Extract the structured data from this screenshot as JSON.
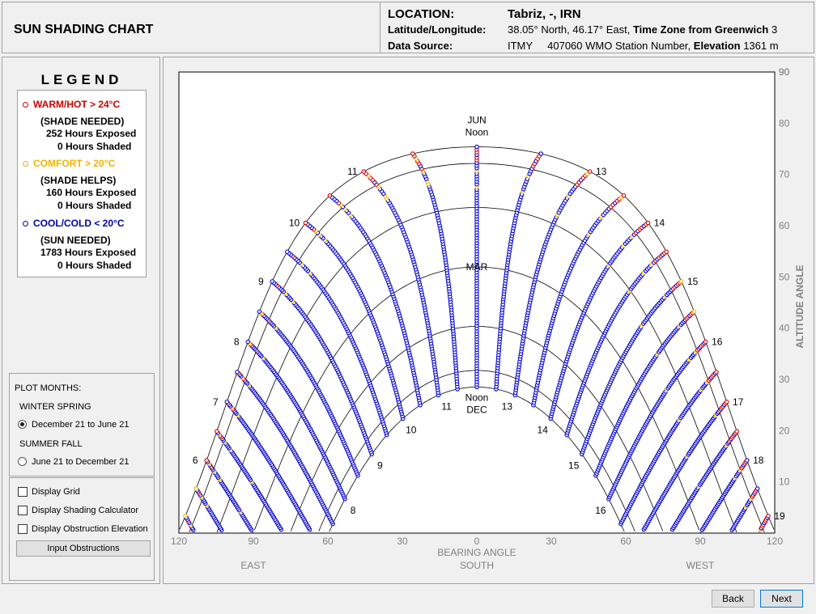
{
  "app": {
    "title": "SUN SHADING CHART"
  },
  "location": {
    "label": "LOCATION:",
    "name": "Tabriz, -, IRN",
    "latlon_label": "Latitude/Longitude:",
    "latlon_value": "38.05° North, 46.17° East,",
    "timezone_label": "Time Zone from Greenwich",
    "timezone_value": "3",
    "source_label": "Data Source:",
    "source_value": "ITMY",
    "station": "407060 WMO Station Number,",
    "elevation_label": "Elevation",
    "elevation_value": "1361 m"
  },
  "legend": {
    "title": "LEGEND",
    "warm": {
      "label": "WARM/HOT  > 24°C",
      "note": "(SHADE NEEDED)",
      "exposed": "252 Hours Exposed",
      "shaded": "0 Hours Shaded",
      "color": "#cc0000"
    },
    "comfort": {
      "label": "COMFORT  > 20°C",
      "note": "(SHADE HELPS)",
      "exposed": "160 Hours Exposed",
      "shaded": "0 Hours Shaded",
      "color": "#f0b400"
    },
    "cool": {
      "label": "COOL/COLD  < 20°C",
      "note": "(SUN NEEDED)",
      "exposed": "1783 Hours Exposed",
      "shaded": "0 Hours Shaded",
      "color": "#0000cc"
    }
  },
  "plot_months": {
    "title": "PLOT MONTHS:",
    "winter_spring_label": "WINTER SPRING",
    "winter_spring_option": "December 21 to June 21",
    "summer_fall_label": "SUMMER FALL",
    "summer_fall_option": "June 21 to December 21",
    "selected": "winter_spring"
  },
  "options": {
    "display_grid": "Display Grid",
    "display_shading_calculator": "Display Shading Calculator",
    "display_obstruction_elevation": "Display Obstruction Elevation",
    "input_obstructions": "Input Obstructions"
  },
  "buttons": {
    "back": "Back",
    "next": "Next"
  },
  "chart_data": {
    "type": "scatter",
    "title": "",
    "xlabel": "BEARING ANGLE",
    "ylabel": "ALTITUDE ANGLE",
    "x_ticks": [
      "120",
      "90",
      "60",
      "30",
      "0",
      "30",
      "60",
      "90",
      "120"
    ],
    "y_ticks": [
      "10",
      "20",
      "30",
      "40",
      "50",
      "60",
      "70",
      "80",
      "90"
    ],
    "xlim": [
      -120,
      120
    ],
    "ylim": [
      0,
      90
    ],
    "direction_labels": {
      "east": "EAST",
      "south": "SOUTH",
      "west": "WEST"
    },
    "latitude": 38.05,
    "sunpath_labels": {
      "jun": [
        "JUN",
        "Noon"
      ],
      "mar": "MAR",
      "dec": [
        "Noon",
        "DEC"
      ]
    },
    "jun_hour_labels": [
      "6",
      "7",
      "8",
      "9",
      "10",
      "11",
      "13",
      "14",
      "15",
      "16",
      "17",
      "18",
      "19"
    ],
    "dec_hour_labels": [
      "8",
      "9",
      "10",
      "11",
      "13",
      "14",
      "15",
      "16"
    ],
    "series": [
      {
        "name": "WARM/HOT > 24°C",
        "color": "#cc0000"
      },
      {
        "name": "COMFORT > 20°C",
        "color": "#f0b400"
      },
      {
        "name": "COOL/COLD < 20°C",
        "color": "#0000cc"
      }
    ]
  }
}
